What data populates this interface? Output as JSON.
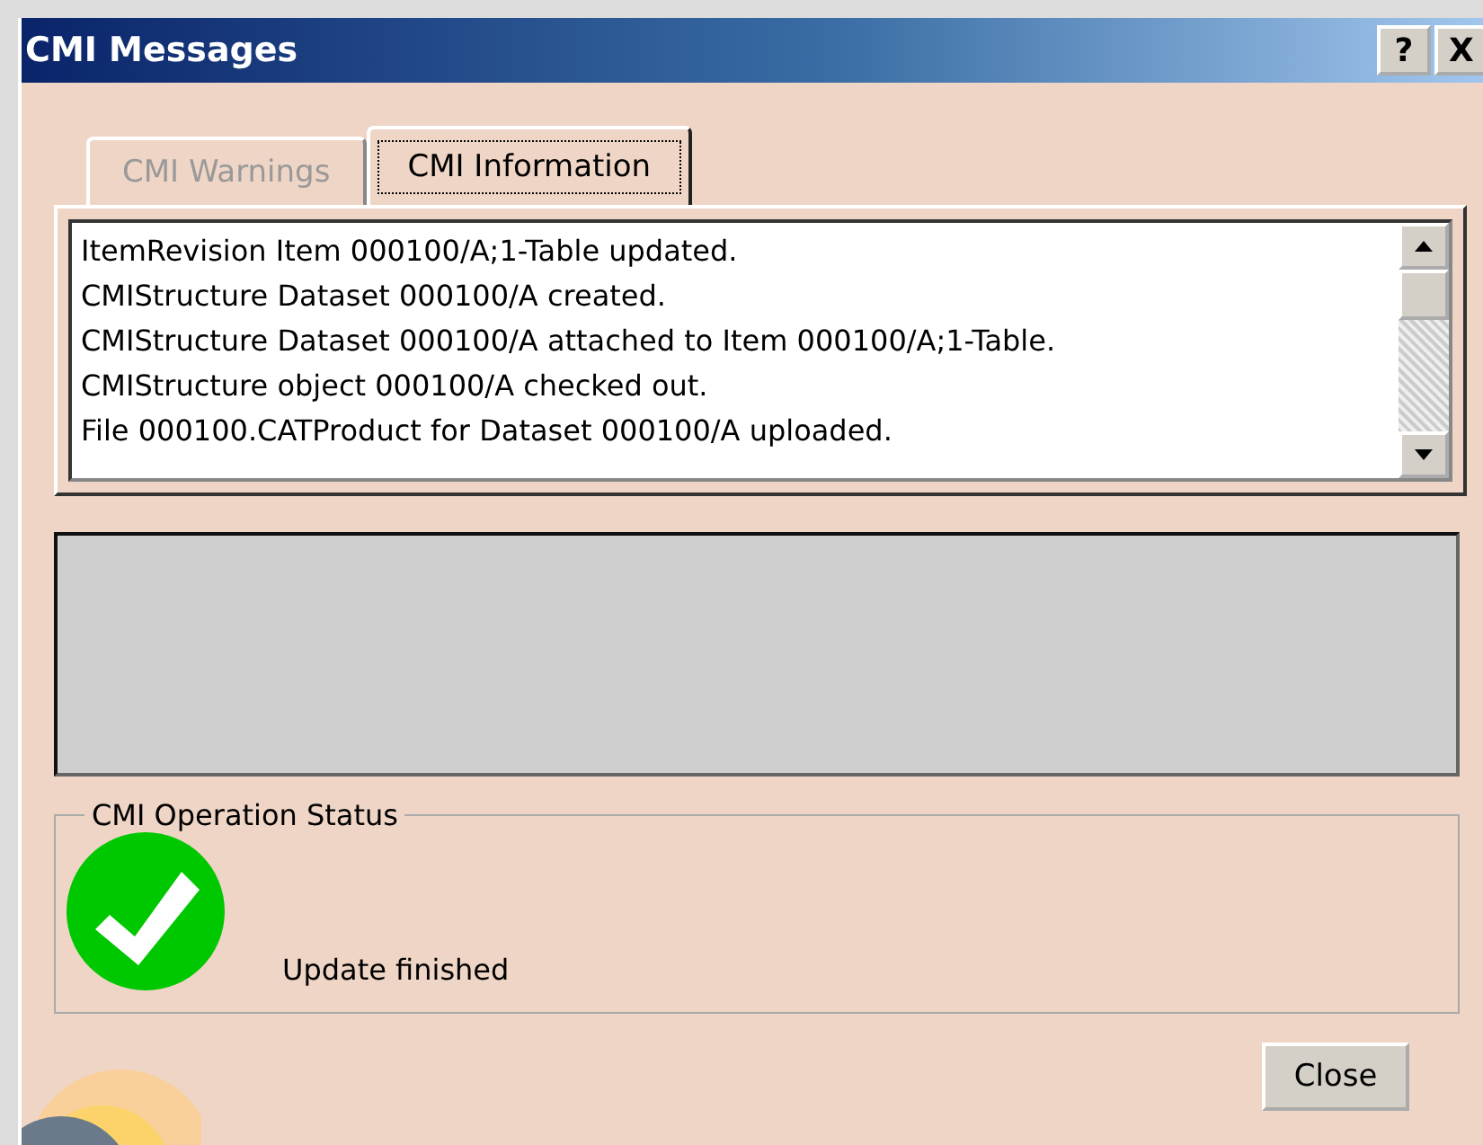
{
  "window": {
    "title": "CMI Messages",
    "help_button": "?",
    "close_button": "X"
  },
  "tabs": [
    {
      "label": "CMI Warnings",
      "selected": false
    },
    {
      "label": "CMI Information",
      "selected": true
    }
  ],
  "messages": [
    "ItemRevision Item 000100/A;1-Table updated.",
    "CMIStructure Dataset 000100/A created.",
    "CMIStructure Dataset 000100/A attached to Item 000100/A;1-Table.",
    "CMIStructure object 000100/A checked out.",
    "File 000100.CATProduct for Dataset 000100/A uploaded."
  ],
  "status": {
    "title": "CMI Operation Status",
    "message": "Update finished"
  },
  "buttons": [
    "Close"
  ]
}
